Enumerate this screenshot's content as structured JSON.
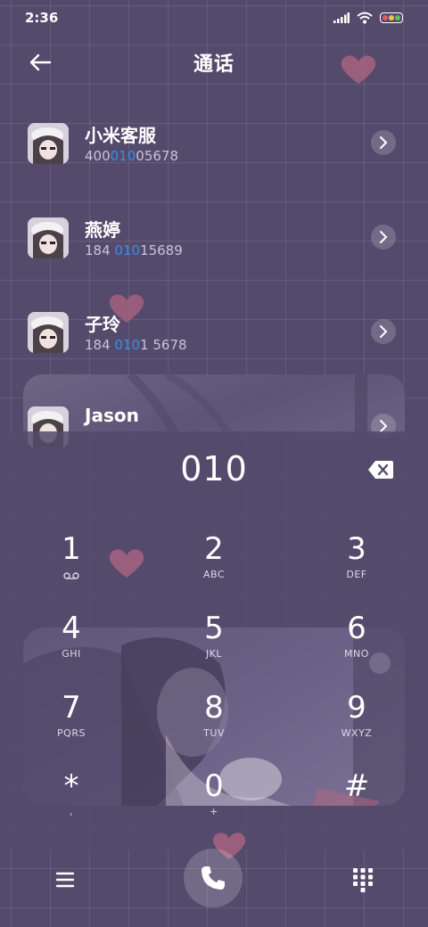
{
  "status_bar": {
    "time": "2:36",
    "icons": [
      "signal-icon",
      "wifi-icon",
      "battery-icon"
    ]
  },
  "header": {
    "title": "通话",
    "back_icon": "arrow-left-icon"
  },
  "contacts": [
    {
      "name": "小米客服",
      "number_before": "400",
      "number_match": "010",
      "number_after": "05678"
    },
    {
      "name": "燕婷",
      "number_before": "184 ",
      "number_match": "010",
      "number_after": "15689"
    },
    {
      "name": "子玲",
      "number_before": "184 ",
      "number_match": "010",
      "number_after": "1 5678"
    },
    {
      "name": "Jason"
    }
  ],
  "dialer": {
    "input": "010",
    "keys": [
      {
        "digit": "1",
        "letters": ""
      },
      {
        "digit": "2",
        "letters": "ABC"
      },
      {
        "digit": "3",
        "letters": "DEF"
      },
      {
        "digit": "4",
        "letters": "GHI"
      },
      {
        "digit": "5",
        "letters": "JKL"
      },
      {
        "digit": "6",
        "letters": "MNO"
      },
      {
        "digit": "7",
        "letters": "PQRS"
      },
      {
        "digit": "8",
        "letters": "TUV"
      },
      {
        "digit": "9",
        "letters": "WXYZ"
      },
      {
        "digit": "*",
        "letters": ","
      },
      {
        "digit": "0",
        "letters": "+"
      },
      {
        "digit": "#",
        "letters": ""
      }
    ]
  },
  "bottom_bar": {
    "icons": [
      "menu-icon",
      "phone-icon",
      "dialpad-icon"
    ]
  },
  "colors": {
    "background": "#544a6c",
    "match_highlight": "#3b8ee8",
    "heart": "#a6637f"
  }
}
